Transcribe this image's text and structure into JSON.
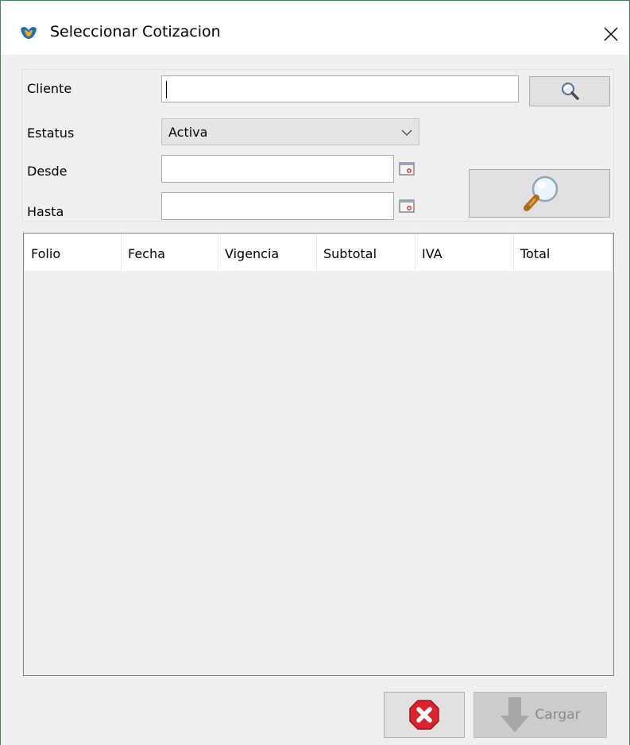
{
  "window": {
    "title": "Seleccionar Cotizacion",
    "app_icon": "app-logo-icon",
    "close_icon": "close-icon"
  },
  "filters": {
    "cliente_label": "Cliente",
    "cliente_value": "",
    "estatus_label": "Estatus",
    "estatus_value": "Activa",
    "desde_label": "Desde",
    "desde_value": "",
    "hasta_label": "Hasta",
    "hasta_value": ""
  },
  "table": {
    "columns": [
      "Folio",
      "Fecha",
      "Vigencia",
      "Subtotal",
      "IVA",
      "Total"
    ],
    "rows": []
  },
  "buttons": {
    "cancel_icon": "cancel-x-icon",
    "load_label": "Cargar",
    "load_icon": "arrow-down-icon",
    "search_client_icon": "magnifier-icon",
    "search_icon": "large-magnifier-icon"
  }
}
